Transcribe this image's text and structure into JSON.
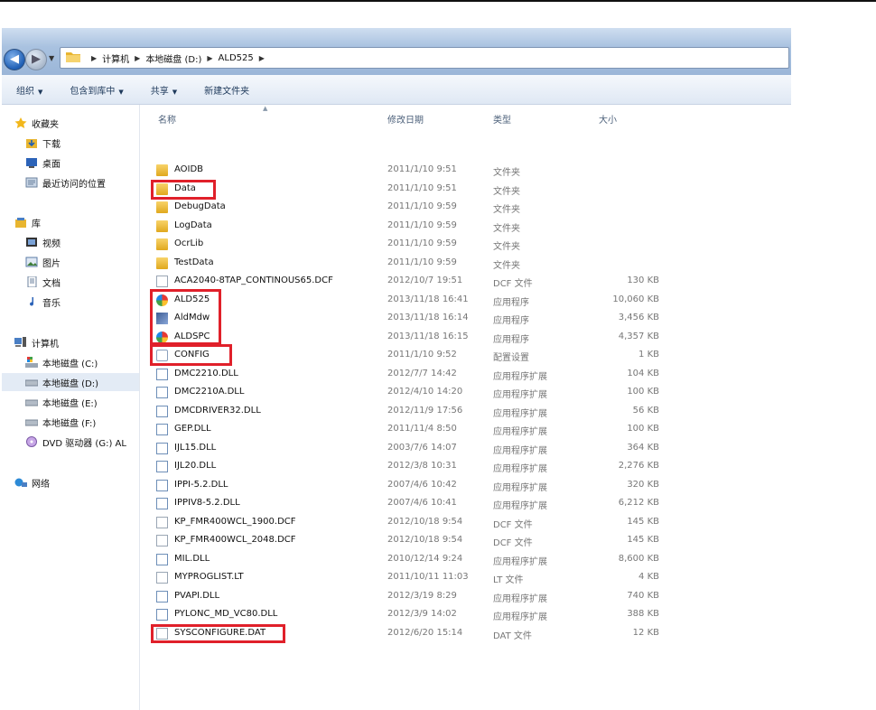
{
  "address": {
    "crumbs": [
      "计算机",
      "本地磁盘 (D:)",
      "ALD525"
    ]
  },
  "toolbar": {
    "organize": "组织",
    "include_library": "包含到库中",
    "share": "共享",
    "new_folder": "新建文件夹"
  },
  "sidebar": {
    "favorites": "收藏夹",
    "downloads": "下载",
    "desktop": "桌面",
    "recent": "最近访问的位置",
    "libraries": "库",
    "videos": "视频",
    "pictures": "图片",
    "documents": "文档",
    "music": "音乐",
    "computer": "计算机",
    "drive_c": "本地磁盘 (C:)",
    "drive_d": "本地磁盘 (D:)",
    "drive_e": "本地磁盘 (E:)",
    "drive_f": "本地磁盘 (F:)",
    "dvd": "DVD 驱动器 (G:) AL",
    "network": "网络"
  },
  "columns": {
    "name": "名称",
    "date": "修改日期",
    "type": "类型",
    "size": "大小"
  },
  "files": [
    {
      "name": "AOIDB",
      "date": "2011/1/10 9:51",
      "type": "文件夹",
      "size": "",
      "icon": "folder-icon"
    },
    {
      "name": "Data",
      "date": "2011/1/10 9:51",
      "type": "文件夹",
      "size": "",
      "icon": "folder-icon"
    },
    {
      "name": "DebugData",
      "date": "2011/1/10 9:59",
      "type": "文件夹",
      "size": "",
      "icon": "folder-icon"
    },
    {
      "name": "LogData",
      "date": "2011/1/10 9:59",
      "type": "文件夹",
      "size": "",
      "icon": "folder-icon"
    },
    {
      "name": "OcrLib",
      "date": "2011/1/10 9:59",
      "type": "文件夹",
      "size": "",
      "icon": "folder-icon"
    },
    {
      "name": "TestData",
      "date": "2011/1/10 9:59",
      "type": "文件夹",
      "size": "",
      "icon": "folder-icon"
    },
    {
      "name": "ACA2040-8TAP_CONTINOUS65.DCF",
      "date": "2012/10/7 19:51",
      "type": "DCF 文件",
      "size": "130 KB",
      "icon": "file-icon"
    },
    {
      "name": "ALD525",
      "date": "2013/11/18 16:41",
      "type": "应用程序",
      "size": "10,060 KB",
      "icon": "app-icon"
    },
    {
      "name": "AldMdw",
      "date": "2013/11/18 16:14",
      "type": "应用程序",
      "size": "3,456 KB",
      "icon": "mdw-app-icon"
    },
    {
      "name": "ALDSPC",
      "date": "2013/11/18 16:15",
      "type": "应用程序",
      "size": "4,357 KB",
      "icon": "app-icon"
    },
    {
      "name": "CONFIG",
      "date": "2011/1/10 9:52",
      "type": "配置设置",
      "size": "1 KB",
      "icon": "config-icon"
    },
    {
      "name": "DMC2210.DLL",
      "date": "2012/7/7 14:42",
      "type": "应用程序扩展",
      "size": "104 KB",
      "icon": "dll-icon"
    },
    {
      "name": "DMC2210A.DLL",
      "date": "2012/4/10 14:20",
      "type": "应用程序扩展",
      "size": "100 KB",
      "icon": "dll-icon"
    },
    {
      "name": "DMCDRIVER32.DLL",
      "date": "2012/11/9 17:56",
      "type": "应用程序扩展",
      "size": "56 KB",
      "icon": "dll-icon"
    },
    {
      "name": "GEP.DLL",
      "date": "2011/11/4 8:50",
      "type": "应用程序扩展",
      "size": "100 KB",
      "icon": "dll-icon"
    },
    {
      "name": "IJL15.DLL",
      "date": "2003/7/6 14:07",
      "type": "应用程序扩展",
      "size": "364 KB",
      "icon": "dll-icon"
    },
    {
      "name": "IJL20.DLL",
      "date": "2012/3/8 10:31",
      "type": "应用程序扩展",
      "size": "2,276 KB",
      "icon": "dll-icon"
    },
    {
      "name": "IPPI-5.2.DLL",
      "date": "2007/4/6 10:42",
      "type": "应用程序扩展",
      "size": "320 KB",
      "icon": "dll-icon"
    },
    {
      "name": "IPPIV8-5.2.DLL",
      "date": "2007/4/6 10:41",
      "type": "应用程序扩展",
      "size": "6,212 KB",
      "icon": "dll-icon"
    },
    {
      "name": "KP_FMR400WCL_1900.DCF",
      "date": "2012/10/18 9:54",
      "type": "DCF 文件",
      "size": "145 KB",
      "icon": "file-icon"
    },
    {
      "name": "KP_FMR400WCL_2048.DCF",
      "date": "2012/10/18 9:54",
      "type": "DCF 文件",
      "size": "145 KB",
      "icon": "file-icon"
    },
    {
      "name": "MIL.DLL",
      "date": "2010/12/14 9:24",
      "type": "应用程序扩展",
      "size": "8,600 KB",
      "icon": "dll-icon"
    },
    {
      "name": "MYPROGLIST.LT",
      "date": "2011/10/11 11:03",
      "type": "LT 文件",
      "size": "4 KB",
      "icon": "file-icon"
    },
    {
      "name": "PVAPI.DLL",
      "date": "2012/3/19 8:29",
      "type": "应用程序扩展",
      "size": "740 KB",
      "icon": "dll-icon"
    },
    {
      "name": "PYLONC_MD_VC80.DLL",
      "date": "2012/3/9 14:02",
      "type": "应用程序扩展",
      "size": "388 KB",
      "icon": "dll-icon"
    },
    {
      "name": "SYSCONFIGURE.DAT",
      "date": "2012/6/20 15:14",
      "type": "DAT 文件",
      "size": "12 KB",
      "icon": "file-icon"
    }
  ],
  "highlight_color": "#e0202a"
}
